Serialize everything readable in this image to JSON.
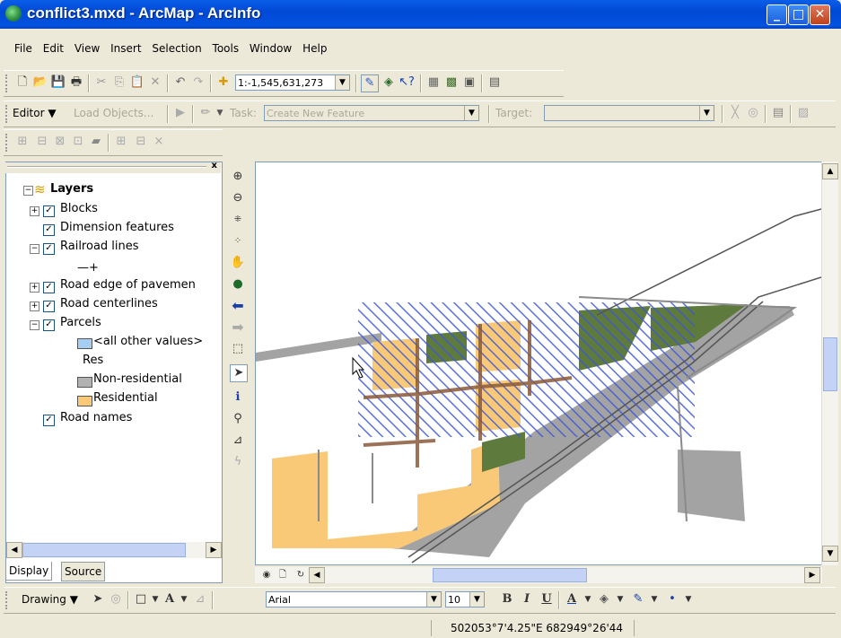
{
  "window": {
    "title": "conflict3.mxd - ArcMap - ArcInfo"
  },
  "menu": [
    "File",
    "Edit",
    "View",
    "Insert",
    "Selection",
    "Tools",
    "Window",
    "Help"
  ],
  "standard_toolbar": {
    "scale": "1:-1,545,631,273"
  },
  "editor_toolbar": {
    "editor_label": "Editor",
    "load_objects": "Load Objects...",
    "task_label": "Task:",
    "task_value": "Create New Feature",
    "target_label": "Target:",
    "target_value": ""
  },
  "toc": {
    "root": "Layers",
    "layers": [
      {
        "name": "Blocks",
        "expander": "+",
        "checked": true
      },
      {
        "name": "Dimension features",
        "expander": "",
        "checked": true
      },
      {
        "name": "Railroad lines",
        "expander": "-",
        "checked": true
      },
      {
        "name": "Road  edge of pavemen",
        "expander": "+",
        "checked": true
      },
      {
        "name": "Road centerlines",
        "expander": "+",
        "checked": true
      },
      {
        "name": "Parcels",
        "expander": "-",
        "checked": true
      },
      {
        "name": "Road names",
        "expander": "",
        "checked": true
      }
    ],
    "railroad_symbol": "—+",
    "parcel_legend": [
      {
        "label": "<all other values>",
        "color": "#a6cdf2"
      },
      {
        "label": "Res",
        "color": ""
      },
      {
        "label": "Non-residential",
        "color": "#b2b2b2"
      },
      {
        "label": "Residential",
        "color": "#f9c978"
      }
    ],
    "tabs": [
      "Display",
      "Source"
    ]
  },
  "drawing_toolbar": {
    "drawing_label": "Drawing",
    "font": "Arial",
    "font_size": "10",
    "bold": "B",
    "italic": "I",
    "underline": "U",
    "font_color": "A"
  },
  "status_bar": {
    "coordinates": "502053°7'4.25\"E  682949°26'44"
  },
  "colors": {
    "title_blue": "#0054e3",
    "parcel_blue": "#3d57d8",
    "residential": "#f9c978",
    "nonres": "#a3a3a3",
    "green": "#5e7a3c"
  }
}
